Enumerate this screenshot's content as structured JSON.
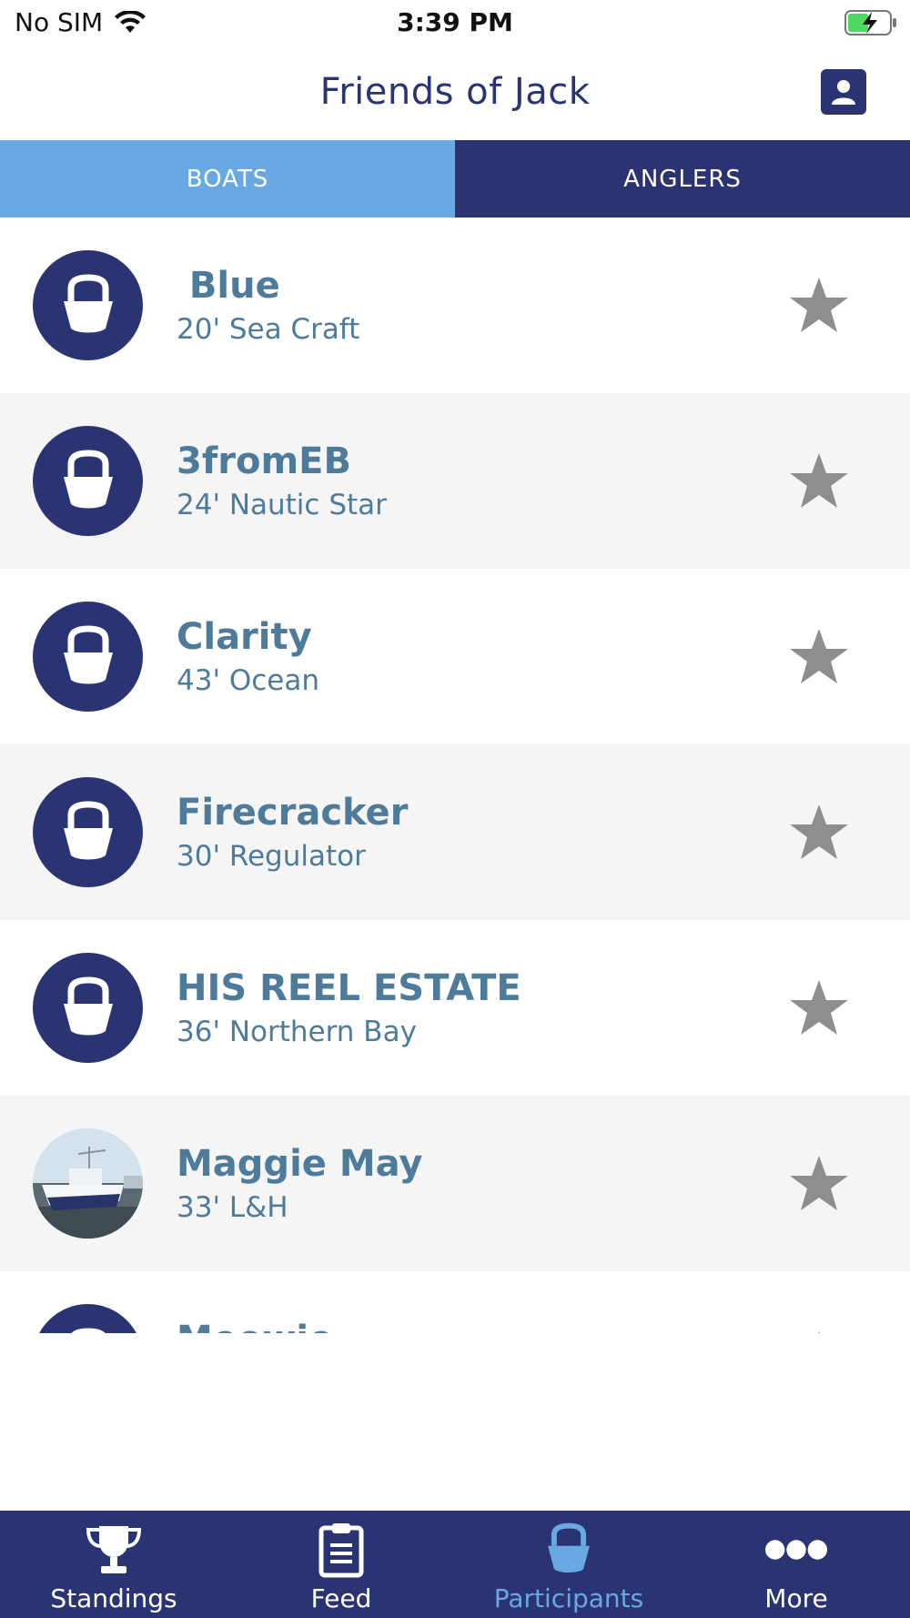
{
  "status_bar": {
    "carrier": "No SIM",
    "time": "3:39 PM"
  },
  "header": {
    "title": "Friends of Jack",
    "profile_icon": "user-icon"
  },
  "tabs": [
    {
      "label": "BOATS",
      "active": true
    },
    {
      "label": "ANGLERS",
      "active": false
    }
  ],
  "boats": [
    {
      "name": " Blue",
      "description": "20' Sea Craft",
      "avatar": "boat-icon",
      "starred": false
    },
    {
      "name": "3fromEB",
      "description": "24' Nautic Star",
      "avatar": "boat-icon",
      "starred": false
    },
    {
      "name": "Clarity",
      "description": "43' Ocean",
      "avatar": "boat-icon",
      "starred": false
    },
    {
      "name": "Firecracker",
      "description": "30' Regulator",
      "avatar": "boat-icon",
      "starred": false
    },
    {
      "name": "HIS REEL ESTATE",
      "description": "36' Northern Bay",
      "avatar": "boat-icon",
      "starred": false
    },
    {
      "name": "Maggie May",
      "description": "33' L&H",
      "avatar": "boat-photo",
      "starred": false
    },
    {
      "name": "Meowie",
      "description": "",
      "avatar": "boat-icon",
      "starred": false
    }
  ],
  "bottom_nav": [
    {
      "label": "Standings",
      "icon": "trophy-icon",
      "active": false
    },
    {
      "label": "Feed",
      "icon": "clipboard-icon",
      "active": false
    },
    {
      "label": "Participants",
      "icon": "boat-icon",
      "active": true
    },
    {
      "label": "More",
      "icon": "more-dots-icon",
      "active": false
    }
  ],
  "colors": {
    "primary": "#2b3472",
    "accent": "#68a9e4",
    "text": "#4f7b9b",
    "star": "#8e8e8e"
  }
}
